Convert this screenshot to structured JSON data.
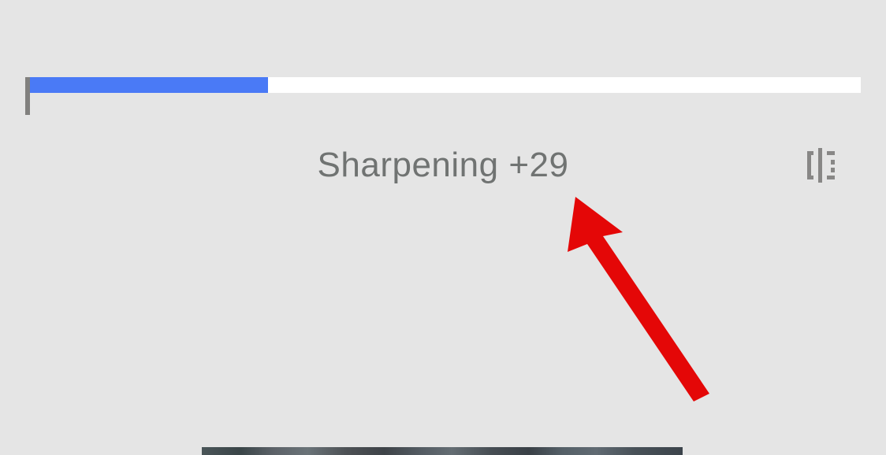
{
  "slider": {
    "label": "Sharpening +29",
    "value": 29,
    "fill_percent": 28.8
  },
  "icons": {
    "compare": "compare-split-icon"
  },
  "colors": {
    "accent": "#4a7af6",
    "background": "#e5e5e5",
    "track": "#ffffff",
    "text": "#707372",
    "icon": "#888786",
    "annotation": "#e40707"
  }
}
